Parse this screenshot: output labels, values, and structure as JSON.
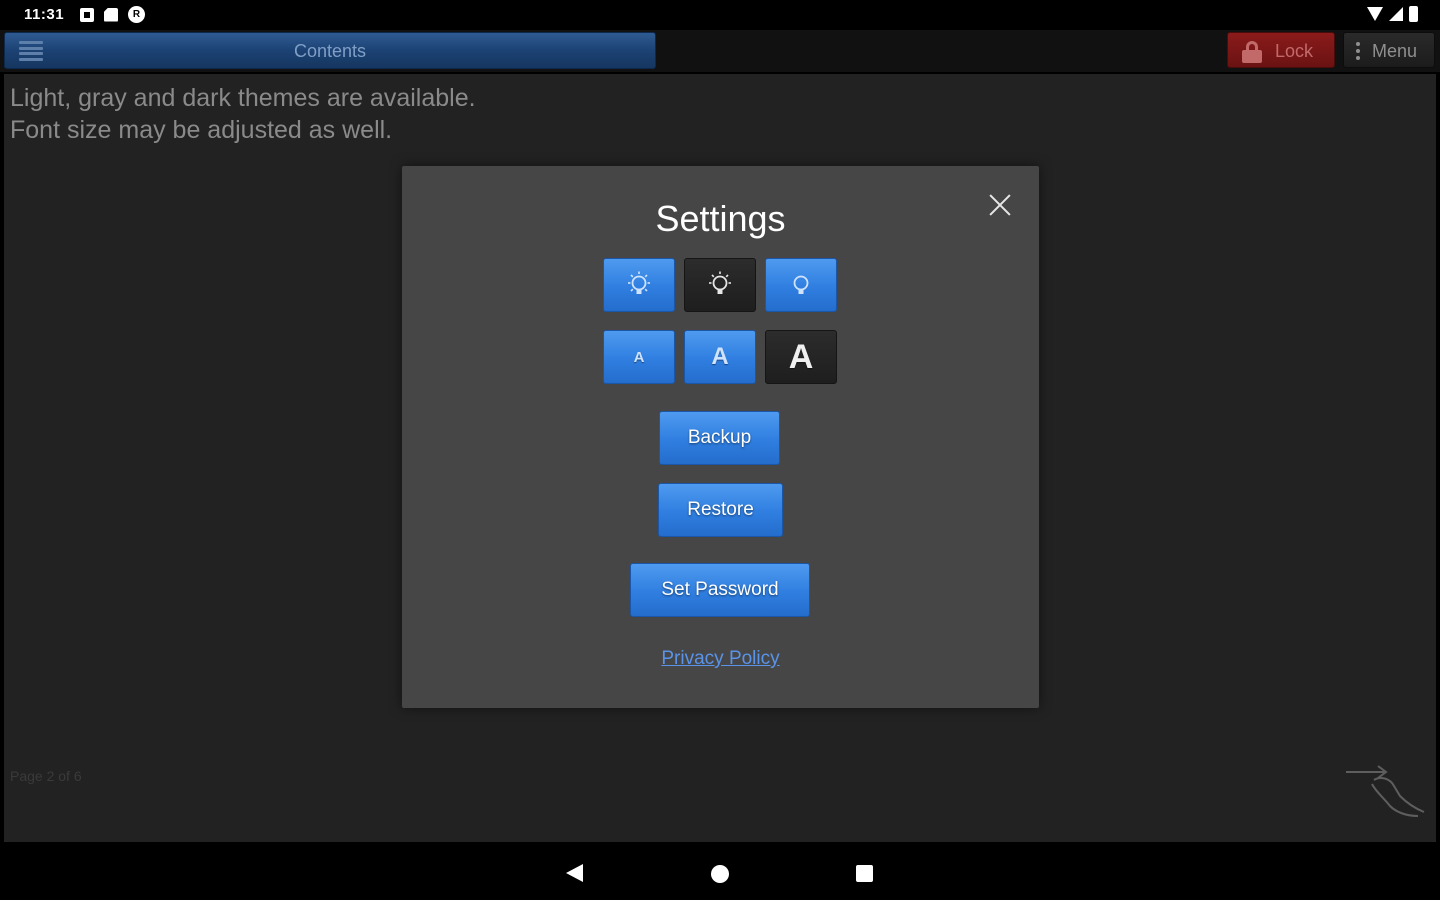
{
  "status_bar": {
    "time": "11:31"
  },
  "app_bar": {
    "contents_label": "Contents",
    "lock_label": "Lock",
    "menu_label": "Menu",
    "colors": {
      "contents_bar": "#1c4274",
      "lock": "#7a1616",
      "menu": "#222222"
    }
  },
  "content": {
    "line1": "Light, gray and dark themes are available.",
    "line2": "Font size may be adjusted as well.",
    "page_indicator": "Page 2 of 6"
  },
  "settings_dialog": {
    "title": "Settings",
    "theme_options": [
      {
        "icon": "light-theme-bulb-icon",
        "selected": false
      },
      {
        "icon": "gray-theme-bulb-icon",
        "selected": true
      },
      {
        "icon": "dark-theme-bulb-icon",
        "selected": false
      }
    ],
    "font_size_options": [
      {
        "label": "A",
        "size": "small",
        "selected": false
      },
      {
        "label": "A",
        "size": "medium",
        "selected": false
      },
      {
        "label": "A",
        "size": "large",
        "selected": true
      }
    ],
    "backup_label": "Backup",
    "restore_label": "Restore",
    "set_password_label": "Set Password",
    "privacy_policy_label": "Privacy Policy",
    "colors": {
      "button_blue": "#2f7ee0",
      "selected_dark": "#1e1e1e",
      "link": "#5a93e8"
    }
  }
}
